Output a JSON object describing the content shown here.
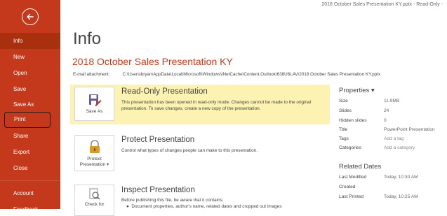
{
  "window_title": "2018 October Sales Presentation KY.pptx  -  Read-Only  -",
  "sidebar": {
    "items": [
      {
        "label": "Info"
      },
      {
        "label": "New"
      },
      {
        "label": "Open"
      },
      {
        "label": "Save"
      },
      {
        "label": "Save As"
      },
      {
        "label": "Print"
      },
      {
        "label": "Share"
      },
      {
        "label": "Export"
      },
      {
        "label": "Close"
      },
      {
        "label": "Account"
      },
      {
        "label": "Feedback"
      }
    ],
    "accent": "#c4391b"
  },
  "page_title": "Info",
  "document_title": "2018 October Sales Presentation KY",
  "email_attachment": {
    "label": "E-mail attachment:",
    "path": "C:\\Users\\bryan\\AppData\\Local\\Microsoft\\Windows\\INetCache\\Content.Outlook\\638U6LAV\\2018 October Sales Presentation KY.pptx"
  },
  "readonly_card": {
    "button_label": "Save As",
    "heading": "Read-Only Presentation",
    "text": "This presentation has been opened in read-only mode. Changes cannot be made to the original presentation. To save changes, create a new copy of the presentation.",
    "bg_color": "#fcf2b1"
  },
  "protect_card": {
    "button_label": "Protect Presentation ▾",
    "button_label_line1": "Protect",
    "button_label_line2": "Presentation ▾",
    "heading": "Protect Presentation",
    "text": "Control what types of changes people can make to this presentation."
  },
  "inspect_card": {
    "button_label": "Check for",
    "heading": "Inspect Presentation",
    "text": "Before publishing this file, be aware that it contains:",
    "bullet": "Document properties, author's name, related dates and cropped out images"
  },
  "properties": {
    "heading": "Properties ▾",
    "rows": [
      {
        "label": "Size",
        "value": "11.9MB"
      },
      {
        "label": "Slides",
        "value": "24"
      },
      {
        "label": "Hidden slides",
        "value": "0"
      },
      {
        "label": "Title",
        "value": "PowerPoint Presentation"
      },
      {
        "label": "Tags",
        "value": "Add a tag"
      },
      {
        "label": "Categories",
        "value": "Add a category"
      }
    ]
  },
  "related_dates": {
    "heading": "Related Dates",
    "rows": [
      {
        "label": "Last Modified",
        "value": "Today, 10:30 AM"
      },
      {
        "label": "Created",
        "value": ""
      },
      {
        "label": "Last Printed",
        "value": "Today, 10:25 AM"
      }
    ]
  }
}
